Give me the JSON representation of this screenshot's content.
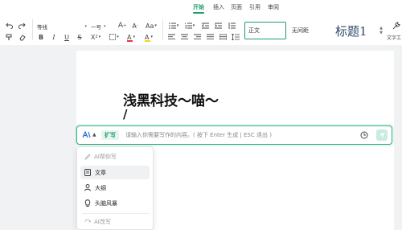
{
  "menu_tabs": [
    {
      "label": "开始",
      "active": true
    },
    {
      "label": "插入",
      "active": false
    },
    {
      "label": "页面",
      "active": false
    },
    {
      "label": "引用",
      "active": false
    },
    {
      "label": "审阅",
      "active": false
    }
  ],
  "toolbar": {
    "font_family": "等线",
    "font_size": "一号",
    "grow_font": "A",
    "shrink_font": "A",
    "font_case": "Aa",
    "bold": "B",
    "italic": "I",
    "underline": "U",
    "strikethrough": "S",
    "superscript_subscript": "X",
    "font_color": "A",
    "highlight": "A",
    "styles": [
      "正文",
      "无间距",
      "标题1"
    ],
    "text_tools": "文字工"
  },
  "document": {
    "title": "浅黑科技～喵～",
    "cursor_line": "/"
  },
  "ai_bar": {
    "logo": "A\\",
    "mode_label": "扩写",
    "placeholder": "请输入你需要写作的内容。( 按下 Enter 生成 | ESC 退出 )"
  },
  "ai_menu": {
    "section1_label": "AI帮你写",
    "items": [
      {
        "label": "文章",
        "icon": "document-icon"
      },
      {
        "label": "大纲",
        "icon": "outline-icon"
      },
      {
        "label": "头脑风暴",
        "icon": "lightbulb-icon"
      }
    ],
    "section2_label": "AI改写"
  },
  "colors": {
    "accent": "#1f9d6b",
    "ai_border": "#32b07f"
  }
}
